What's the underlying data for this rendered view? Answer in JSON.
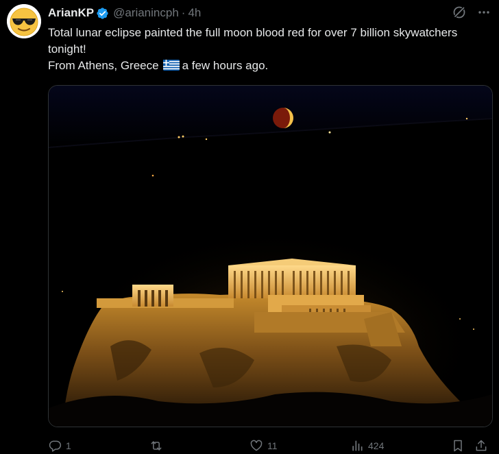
{
  "tweet": {
    "author_name": "ArianKP",
    "handle": "@arianincph",
    "separator": "·",
    "time": "4h",
    "text_line1": "Total lunar eclipse painted the full moon blood red for over 7 billion skywatchers tonight!",
    "text_line2_before": "From Athens, Greece",
    "text_line2_after": "a few hours ago.",
    "avatar_icon": "sunglasses-emoji-icon",
    "flag_icon": "greece-flag-icon",
    "media_description_icon": "acropolis-night-photo"
  },
  "actions": {
    "reply_count": "1",
    "retweet_count": "",
    "like_count": "11",
    "views_count": "424"
  },
  "colors": {
    "background": "#000000",
    "text": "#e7e9ea",
    "muted": "#71767b",
    "verified": "#1d9bf0",
    "border": "#2f3336"
  }
}
